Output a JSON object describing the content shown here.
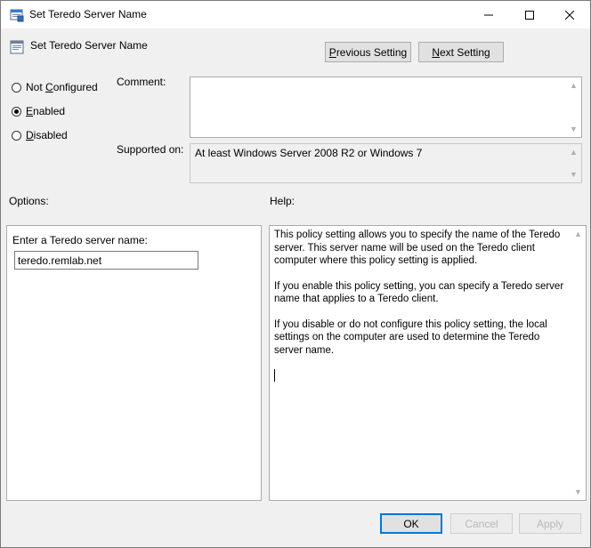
{
  "window": {
    "title": "Set Teredo Server Name",
    "icons": {
      "app": "policy-dialog-icon",
      "minimize": "minimize-icon",
      "maximize": "maximize-icon",
      "close": "close-icon"
    }
  },
  "header": {
    "policy_name": "Set Teredo Server Name",
    "previous_prefix": "P",
    "previous_rest": "revious Setting",
    "next_prefix": "N",
    "next_rest": "ext Setting"
  },
  "state": {
    "options": [
      {
        "prefix": "Not ",
        "accel": "C",
        "rest": "onfigured",
        "selected": false
      },
      {
        "prefix": "",
        "accel": "E",
        "rest": "nabled",
        "selected": true
      },
      {
        "prefix": "",
        "accel": "D",
        "rest": "isabled",
        "selected": false
      }
    ]
  },
  "comment": {
    "label": "Comment:",
    "value": ""
  },
  "supported": {
    "label": "Supported on:",
    "value": "At least Windows Server 2008 R2 or Windows 7"
  },
  "options_section": {
    "label": "Options:",
    "field_label": "Enter a Teredo server name:",
    "field_value": "teredo.remlab.net"
  },
  "help_section": {
    "label": "Help:",
    "paragraphs": [
      "This policy setting allows you to specify the name of the Teredo server. This server name will be used on the Teredo client computer where this policy setting is applied.",
      "If you enable this policy setting, you can specify a Teredo server name that applies to a Teredo client.",
      "If you disable or do not configure this policy setting, the local settings on the computer are used to determine the Teredo server name."
    ]
  },
  "footer": {
    "ok": "OK",
    "cancel": "Cancel",
    "apply": "Apply"
  }
}
